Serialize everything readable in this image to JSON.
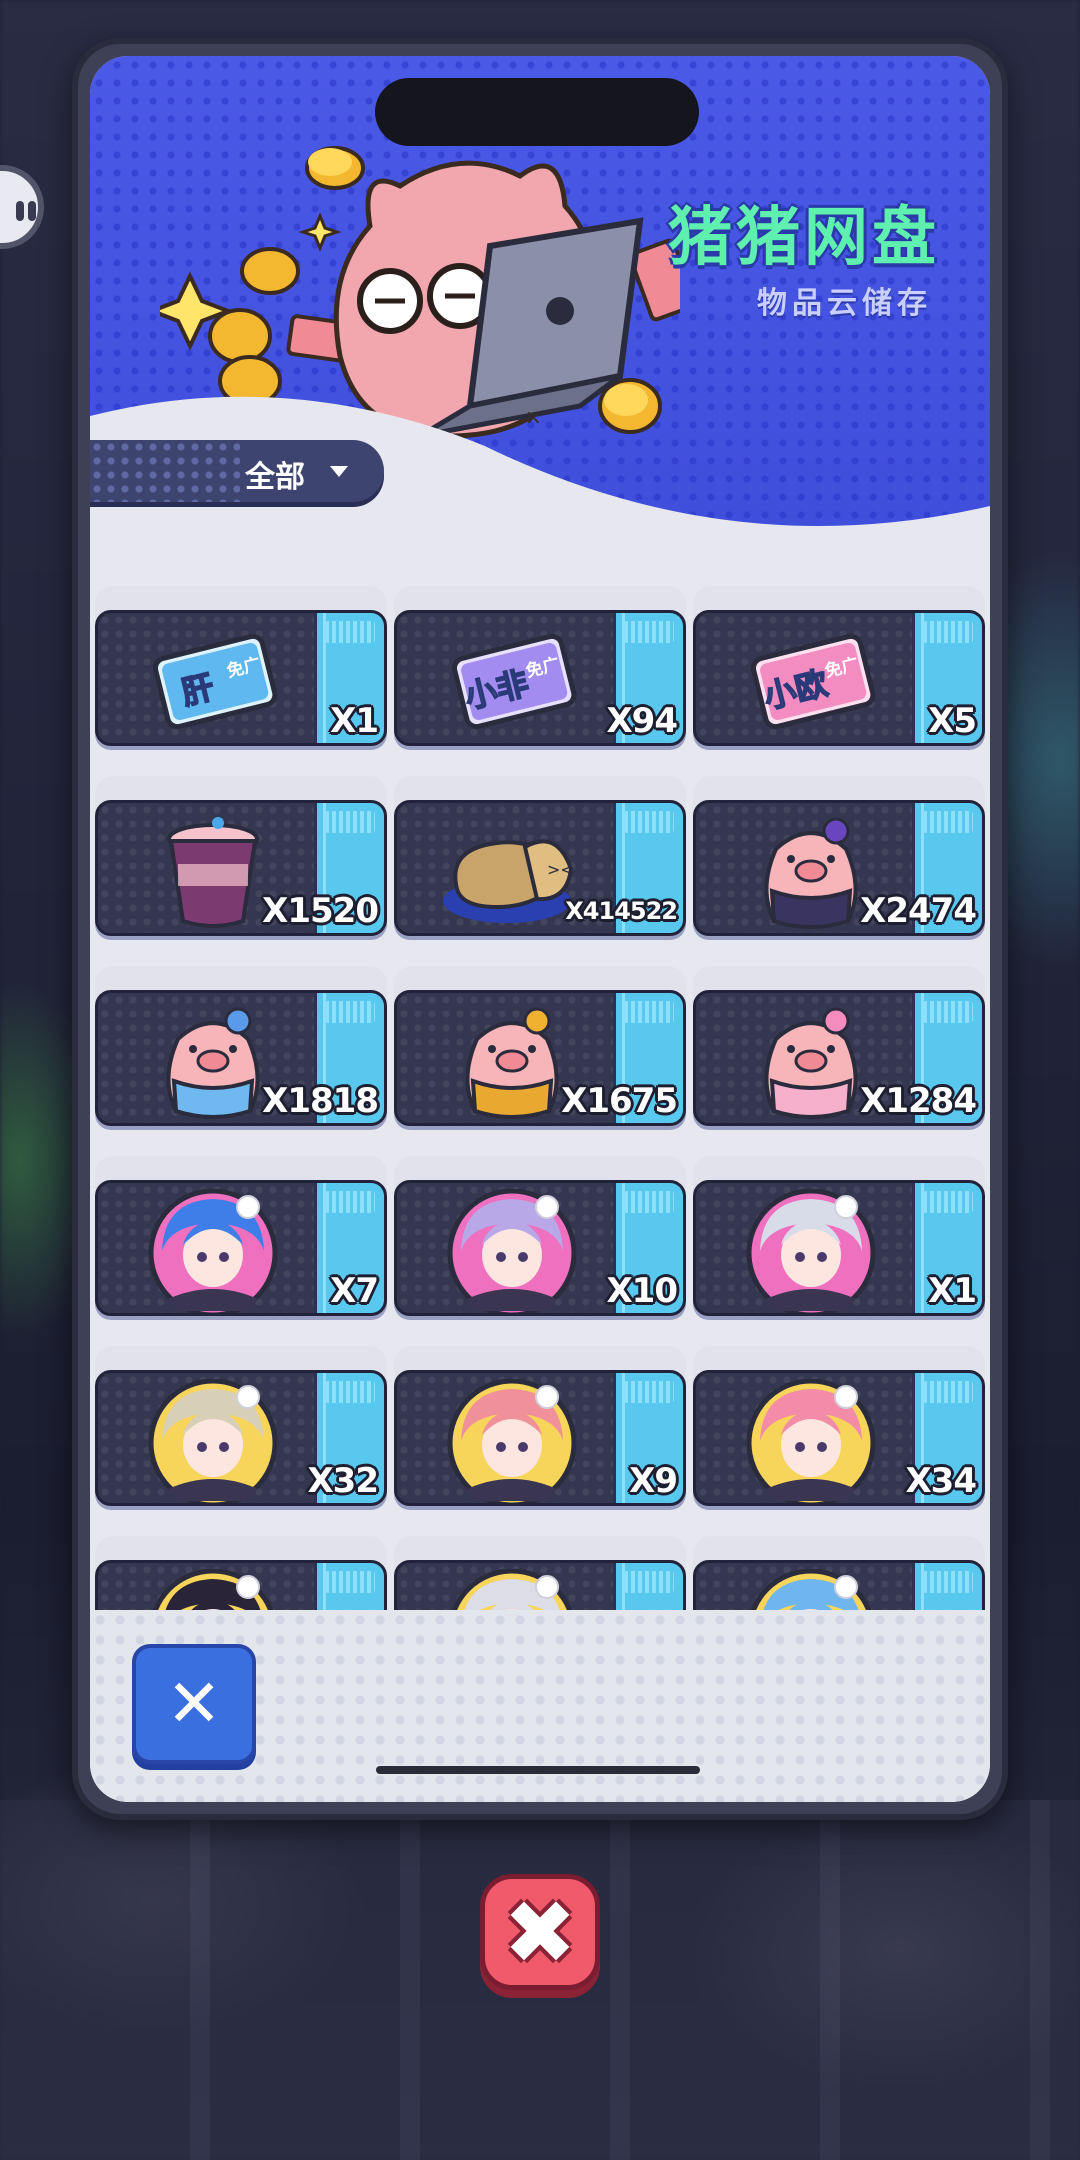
{
  "header": {
    "title": "猪猪网盘",
    "subtitle": "物品云储存"
  },
  "filter": {
    "selected": "全部"
  },
  "items": [
    {
      "icon": "ticket-gan-icon",
      "ticket_text": "肝",
      "ticket_badge": "免广",
      "quantity": "X1"
    },
    {
      "icon": "ticket-xiaofei-icon",
      "ticket_text": "小非",
      "ticket_badge": "免广",
      "quantity": "X94"
    },
    {
      "icon": "ticket-xiaoou-icon",
      "ticket_text": "小欧",
      "ticket_badge": "免广",
      "quantity": "X5"
    },
    {
      "icon": "bubble-tea-cup-icon",
      "quantity": "X1520"
    },
    {
      "icon": "sleeping-snail-bun-icon",
      "quantity": "X414522"
    },
    {
      "icon": "pig-purple-bow-icon",
      "quantity": "X2474"
    },
    {
      "icon": "pig-blue-bandana-icon",
      "quantity": "X1818"
    },
    {
      "icon": "pig-yellow-hat-icon",
      "quantity": "X1675"
    },
    {
      "icon": "pig-pink-bow-icon",
      "quantity": "X1284"
    },
    {
      "icon": "avatar-blue-hair-girl-icon",
      "quantity": "X7"
    },
    {
      "icon": "avatar-lavender-hair-girl-icon",
      "quantity": "X10"
    },
    {
      "icon": "avatar-silver-hair-girl-icon",
      "quantity": "X1"
    },
    {
      "icon": "avatar-blonde-girl-icon",
      "quantity": "X32"
    },
    {
      "icon": "avatar-pink-hair-girl-icon",
      "quantity": "X9"
    },
    {
      "icon": "avatar-pink-twintail-girl-icon",
      "quantity": "X34"
    },
    {
      "icon": "avatar-black-hair-girl-icon",
      "quantity": ""
    },
    {
      "icon": "avatar-white-hair-girl-icon",
      "quantity": ""
    },
    {
      "icon": "avatar-blue-twintail-girl-icon",
      "quantity": ""
    }
  ],
  "buttons": {
    "close_small": "✕",
    "close_big": "✖"
  },
  "colors": {
    "header_blue": "#4b5ae6",
    "title_green": "#5ff0b0",
    "card_dark": "#353750",
    "card_side": "#59c8ef",
    "close_blue": "#3a6fe0",
    "close_red": "#f05a6a"
  }
}
